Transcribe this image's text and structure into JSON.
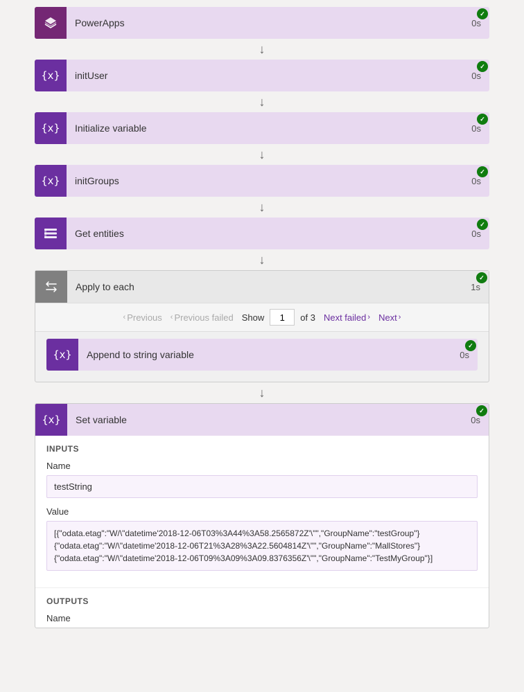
{
  "steps": [
    {
      "id": "powerapps",
      "icon_type": "powerapps",
      "icon_bg": "#742774",
      "bg": "#e8d9f0",
      "title": "PowerApps",
      "duration": "0s",
      "success": true
    },
    {
      "id": "inituser",
      "icon_type": "variable",
      "icon_bg": "#6B2FA0",
      "bg": "#e8d9f0",
      "title": "initUser",
      "duration": "0s",
      "success": true
    },
    {
      "id": "initvariable",
      "icon_type": "variable",
      "icon_bg": "#6B2FA0",
      "bg": "#e8d9f0",
      "title": "Initialize variable",
      "duration": "0s",
      "success": true
    },
    {
      "id": "initgroups",
      "icon_type": "variable",
      "icon_bg": "#6B2FA0",
      "bg": "#e8d9f0",
      "title": "initGroups",
      "duration": "0s",
      "success": true
    },
    {
      "id": "getentities",
      "icon_type": "entities",
      "icon_bg": "#6B2FA0",
      "bg": "#e8d9f0",
      "title": "Get entities",
      "duration": "0s",
      "success": true
    }
  ],
  "loop": {
    "title": "Apply to each",
    "duration": "1s",
    "success": true,
    "pagination": {
      "previous_label": "Previous",
      "previous_failed_label": "Previous failed",
      "show_label": "Show",
      "current_page": "1",
      "total_pages": "3",
      "next_failed_label": "Next failed",
      "next_label": "Next"
    },
    "inner_step": {
      "title": "Append to string variable",
      "duration": "0s",
      "success": true,
      "icon_type": "variable",
      "icon_bg": "#6B2FA0",
      "bg": "#e8d9f0"
    }
  },
  "setvariable": {
    "title": "Set variable",
    "duration": "0s",
    "success": true,
    "icon_type": "variable",
    "icon_bg": "#6B2FA0",
    "bg": "#e8d9f0",
    "inputs": {
      "label": "INPUTS",
      "name_label": "Name",
      "name_value": "testString",
      "value_label": "Value",
      "value_content": "[{\"odata.etag\":\"W/\\\"datetime'2018-12-06T03%3A44%3A58.2565872Z'\\\"\",\"GroupName\":\"testGroup\"} {\"odata.etag\":\"W/\\\"datetime'2018-12-06T21%3A28%3A22.5604814Z'\\\"\",\"GroupName\":\"MallStores\"} {\"odata.etag\":\"W/\\\"datetime'2018-12-06T09%3A09%3A09.8376356Z'\\\"\",\"GroupName\":\"TestMyGroup\"}]"
    },
    "outputs": {
      "label": "OUTPUTS",
      "name_label": "Name"
    }
  }
}
